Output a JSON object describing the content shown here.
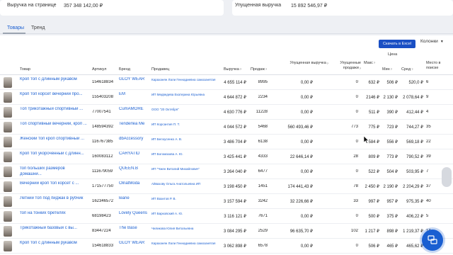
{
  "metrics": [
    {
      "label": "Выручка на странице",
      "value": "357 348 142,00 ₽"
    },
    {
      "label": "Упущенная выручка",
      "value": "15 892 546,97 ₽"
    }
  ],
  "tabs": [
    {
      "label": "Товары",
      "active": true
    },
    {
      "label": "Тренд",
      "active": false
    }
  ],
  "toolbar": {
    "excel": "Скачать в Excel",
    "columns": "Колонки"
  },
  "headers": {
    "product": "Товар",
    "article": "Артикул",
    "brand": "Бренд",
    "seller": "Продавец",
    "revenue": "Выручка",
    "sales": "Продаж",
    "lost_revenue": "Упущенная выручка",
    "lost_sales": "Упущенные продажи",
    "max": "Макс",
    "price": "Цена",
    "min": "Мин",
    "avg": "Сред",
    "place": "Место в поиске",
    "q": "?"
  },
  "rows": [
    {
      "name": "Кроп топ с длинным рукавом",
      "article": "154618834",
      "brand": "GLOY WEAR",
      "seller": "Караханян Лали Геннадиевна самозанятая",
      "revenue": "4 655 114 ₽",
      "sales": "8995",
      "lost_rev": "0,00 ₽",
      "lost_sales": "0",
      "max": "632 ₽",
      "min": "506 ₽",
      "avg": "520,0 ₽",
      "place": "6"
    },
    {
      "name": "Кроп топ корсет вечерний про...",
      "article": "155403208",
      "brand": "EM",
      "seller": "ИП Медведева Екатерина Юрьевна",
      "revenue": "4 644 872 ₽",
      "sales": "2234",
      "lost_rev": "0,00 ₽",
      "lost_sales": "0",
      "max": "2146 ₽",
      "min": "2 130 ₽",
      "avg": "2 078,64 ₽",
      "place": "9"
    },
    {
      "name": "Топ трикотажный спортивный ...",
      "article": "77007541",
      "brand": "CumAMORE",
      "seller": "ООО \"20 Октября\"",
      "revenue": "4 630 776 ₽",
      "sales": "11228",
      "lost_rev": "0,00 ₽",
      "lost_sales": "0",
      "max": "511 ₽",
      "min": "390 ₽",
      "avg": "412,44 ₽",
      "place": "4"
    },
    {
      "name": "Топ спортивный вечерний, кроп ...",
      "article": "148594392",
      "brand": "Tenderlea Me",
      "seller": "ИП Корсантия П. Т.",
      "revenue": "4 044 572 ₽",
      "sales": "5468",
      "lost_rev": "560 493,46 ₽",
      "lost_sales": "773",
      "max": "775 ₽",
      "min": "723 ₽",
      "avg": "744,27 ₽",
      "place": "35"
    },
    {
      "name": "Женский топ кроп спортивный ...",
      "article": "116767385",
      "brand": "dbAccessory",
      "seller": "ИП Белоусенко А. В.",
      "revenue": "3 486 704 ₽",
      "sales": "6138",
      "lost_rev": "0,00 ₽",
      "lost_sales": "0",
      "max": "584 ₽",
      "min": "556 ₽",
      "avg": "569,18 ₽",
      "place": "22"
    },
    {
      "name": "Кроп топ укороченный с длинн...",
      "article": "160083112",
      "brand": "CARYATID",
      "seller": "ИП Богомазова А. Ю.",
      "revenue": "3 425 441 ₽",
      "sales": "4333",
      "lost_rev": "22 646,14 ₽",
      "lost_sales": "28",
      "max": "809 ₽",
      "min": "773 ₽",
      "avg": "790,52 ₽",
      "place": "39"
    },
    {
      "name": "топ больших размеров домашни...",
      "article": "111679059",
      "brand": "QUEEN.B",
      "seller": "ИП \"Чжен Виталий Михайлович\"",
      "revenue": "3 264 040 ₽",
      "sales": "6477",
      "lost_rev": "0,00 ₽",
      "lost_sales": "0",
      "max": "522 ₽",
      "min": "504 ₽",
      "avg": "503,95 ₽",
      "place": "7"
    },
    {
      "name": "Вечерний кроп топ корсет с ...",
      "article": "171577750",
      "brand": "OlnatModa",
      "seller": "Айвазову Ольга Анатольевна ИП",
      "revenue": "3 198 450 ₽",
      "sales": "1451",
      "lost_rev": "174 441,43 ₽",
      "lost_sales": "78",
      "max": "2 450 ₽",
      "min": "2 190 ₽",
      "avg": "2 204,29 ₽",
      "place": "37"
    },
    {
      "name": "Летний топ под пиджак в рубчик",
      "article": "162346572",
      "brand": "leane",
      "seller": "ИП Вазитов Р. В.",
      "revenue": "3 157 594 ₽",
      "sales": "3242",
      "lost_rev": "32 226,66 ₽",
      "lost_sales": "33",
      "max": "997 ₽",
      "min": "957 ₽",
      "avg": "975,35 ₽",
      "place": "40"
    },
    {
      "name": "топ на тонких бретелях",
      "article": "68198423",
      "brand": "Lovely Queens",
      "seller": "ИП Барковский А. Ю.",
      "revenue": "3 116 121 ₽",
      "sales": "7671",
      "lost_rev": "0,00 ₽",
      "lost_sales": "0",
      "max": "500 ₽",
      "min": "375 ₽",
      "avg": "406,22 ₽",
      "place": "5"
    },
    {
      "name": "Трикотажный базовый с вы...",
      "article": "83447224",
      "brand": "The Base",
      "seller": "Чиликова Юлия Витальевна",
      "revenue": "3 084 295 ₽",
      "sales": "2529",
      "lost_rev": "96 635,70 ₽",
      "lost_sales": "102",
      "max": "1 217 ₽",
      "min": "898 ₽",
      "avg": "1 219,37 ₽",
      "place": "14"
    },
    {
      "name": "Кроп топ с длинным рукавом",
      "article": "154618833",
      "brand": "GLOY WEAR",
      "seller": "Караханян Лали Геннадиевна самозанятая",
      "revenue": "3 062 898 ₽",
      "sales": "6578",
      "lost_rev": "0,00 ₽",
      "lost_sales": "0",
      "max": "506 ₽",
      "min": "465 ₽",
      "avg": "465,62 ₽",
      "place": "8"
    }
  ]
}
